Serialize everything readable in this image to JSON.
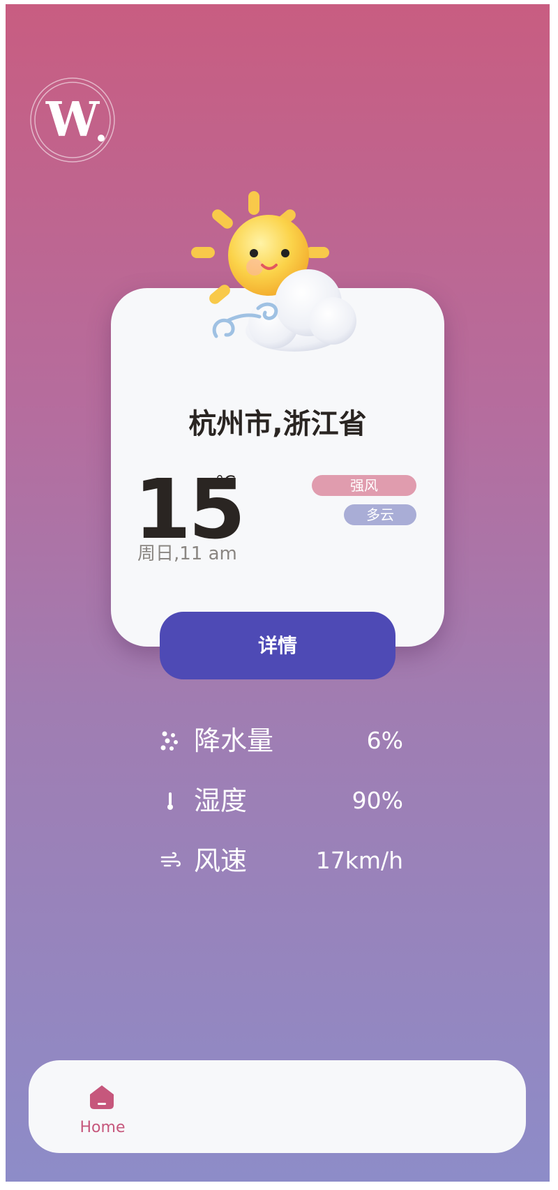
{
  "logo": {
    "letter": "W"
  },
  "card": {
    "city": "杭州市,浙江省",
    "temperature": "15",
    "unit": "°C",
    "datetime": "周日,11 am",
    "tags": [
      "强风",
      "多云"
    ],
    "details_label": "详情"
  },
  "metrics": [
    {
      "icon": "rain-icon",
      "label": "降水量",
      "value": "6%"
    },
    {
      "icon": "thermometer-icon",
      "label": "湿度",
      "value": "90%"
    },
    {
      "icon": "wind-icon",
      "label": "风速",
      "value": "17km/h"
    }
  ],
  "nav": {
    "home_label": "Home"
  },
  "colors": {
    "accent": "#4e4ab5",
    "brand": "#c6577c",
    "tag_wind": "#e09cae",
    "tag_cloud": "#a9add6"
  }
}
